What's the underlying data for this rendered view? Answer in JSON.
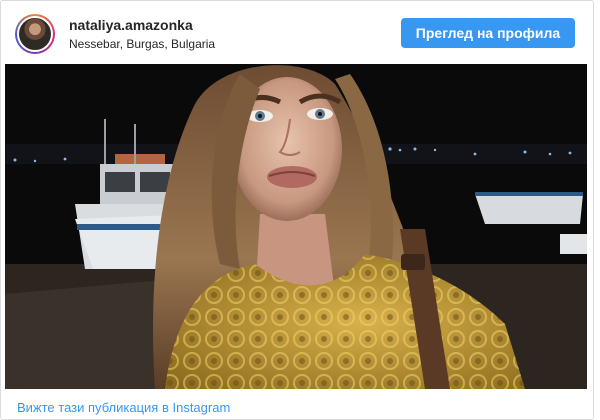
{
  "post": {
    "username": "nataliya.amazonka",
    "location": "Nessebar, Burgas, Bulgaria",
    "view_profile_label": "Преглед на профила",
    "footer_link_label": "Вижте тази публикация в Instagram"
  },
  "icons": {
    "avatar": "profile-avatar"
  },
  "colors": {
    "button_bg": "#3897f0",
    "link": "#3897f0",
    "text": "#262626",
    "border": "#dbdbdb"
  }
}
